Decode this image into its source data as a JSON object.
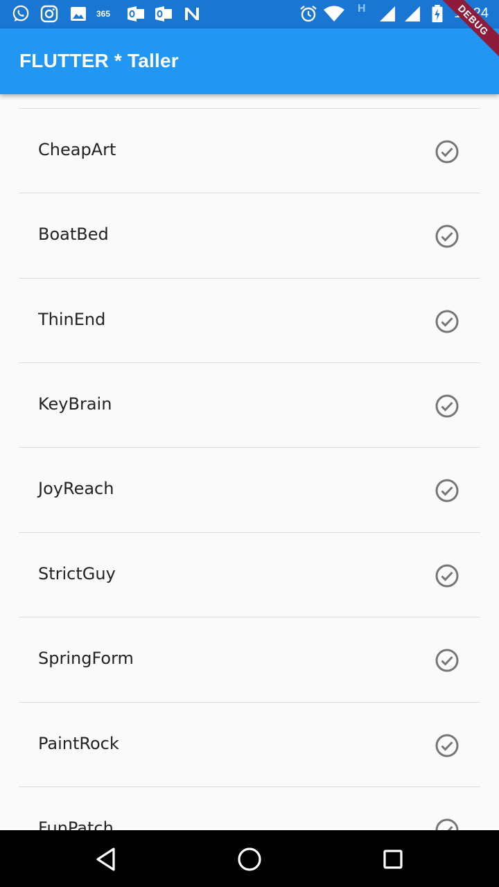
{
  "status_bar": {
    "time": "12:24",
    "left_icons": [
      "whatsapp-icon",
      "instagram-icon",
      "gallery-icon",
      "office365-icon",
      "outlook-icon",
      "outlook-icon",
      "n-app-icon"
    ],
    "right_icons": [
      "alarm-icon",
      "wifi-icon",
      "h-network-icon",
      "signal-icon",
      "signal-icon",
      "battery-charging-icon"
    ],
    "network_label": "H",
    "color": "#1976d2"
  },
  "app_bar": {
    "title": "FLUTTER * Taller",
    "color": "#2196f3"
  },
  "debug_banner": {
    "label": "DEBUG",
    "color": "#8e1b3b"
  },
  "list": {
    "items": [
      {
        "label": "CheapArt",
        "icon": "check-circle-icon"
      },
      {
        "label": "BoatBed",
        "icon": "check-circle-icon"
      },
      {
        "label": "ThinEnd",
        "icon": "check-circle-icon"
      },
      {
        "label": "KeyBrain",
        "icon": "check-circle-icon"
      },
      {
        "label": "JoyReach",
        "icon": "check-circle-icon"
      },
      {
        "label": "StrictGuy",
        "icon": "check-circle-icon"
      },
      {
        "label": "SpringForm",
        "icon": "check-circle-icon"
      },
      {
        "label": "PaintRock",
        "icon": "check-circle-icon"
      },
      {
        "label": "FunPatch",
        "icon": "check-circle-icon"
      }
    ],
    "icon_color": "#757575"
  },
  "nav_bar": {
    "buttons": [
      "back-icon",
      "home-icon",
      "recents-icon"
    ]
  }
}
